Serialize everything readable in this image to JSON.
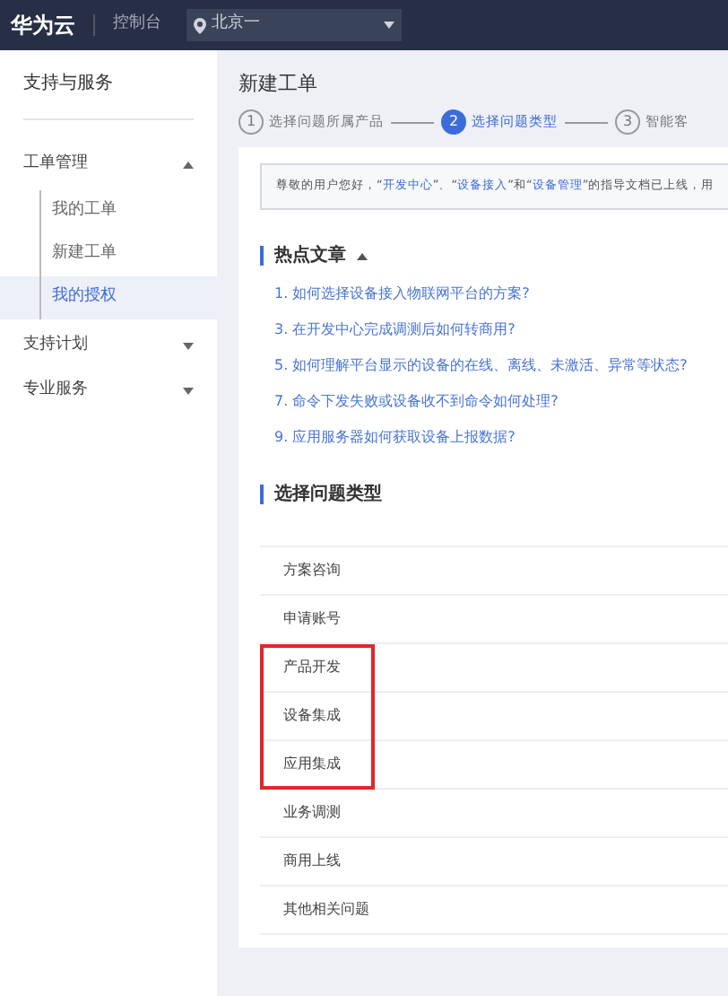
{
  "topbar": {
    "brand": "华为云",
    "console": "控制台",
    "region": "北京一"
  },
  "sidebar": {
    "title": "支持与服务",
    "groups": [
      {
        "label": "工单管理",
        "expanded": true,
        "children": [
          {
            "label": "我的工单",
            "selected": false
          },
          {
            "label": "新建工单",
            "selected": false
          },
          {
            "label": "我的授权",
            "selected": true
          }
        ]
      },
      {
        "label": "支持计划",
        "expanded": false
      },
      {
        "label": "专业服务",
        "expanded": false
      }
    ]
  },
  "page_title": "新建工单",
  "steps": [
    {
      "number": "1",
      "label": "选择问题所属产品",
      "current": false
    },
    {
      "number": "2",
      "label": "选择问题类型",
      "current": true
    },
    {
      "number": "3",
      "label": "智能客",
      "current": false
    }
  ],
  "notice": [
    {
      "kind": "text",
      "text": "尊敬的用户您好，“"
    },
    {
      "kind": "link",
      "text": "开发中心"
    },
    {
      "kind": "text",
      "text": "”、“"
    },
    {
      "kind": "link",
      "text": "设备接入"
    },
    {
      "kind": "text",
      "text": "”和“"
    },
    {
      "kind": "link",
      "text": "设备管理"
    },
    {
      "kind": "text",
      "text": "”的指导文档已上线，用"
    }
  ],
  "hot_articles": {
    "title": "热点文章",
    "expanded": true,
    "items": [
      "1. 如何选择设备接入物联网平台的方案?",
      "3. 在开发中心完成调测后如何转商用?",
      "5. 如何理解平台显示的设备的在线、离线、未激活、异常等状态?",
      "7. 命令下发失败或设备收不到命令如何处理?",
      "9. 应用服务器如何获取设备上报数据?"
    ]
  },
  "problem_types": {
    "title": "选择问题类型",
    "items": [
      {
        "kind": "option",
        "label": "方案咨询"
      },
      {
        "kind": "option",
        "label": "申请账号"
      },
      {
        "kind": "highlight_group",
        "items": [
          "产品开发",
          "设备集成",
          "应用集成"
        ]
      },
      {
        "kind": "option",
        "label": "业务调测"
      },
      {
        "kind": "option",
        "label": "商用上线"
      },
      {
        "kind": "option",
        "label": "其他相关问题"
      }
    ]
  }
}
